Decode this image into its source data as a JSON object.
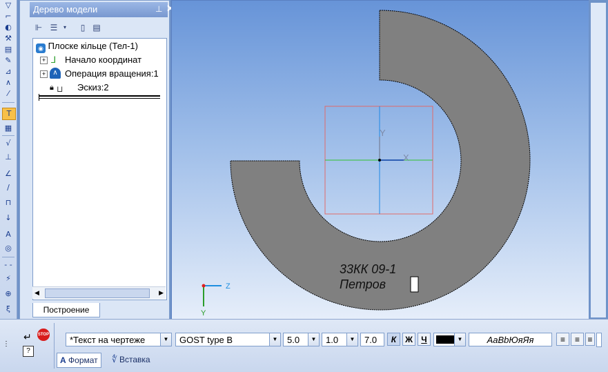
{
  "tree": {
    "title": "Дерево модели",
    "pin_icon": "pin-icon",
    "close_label": "✕",
    "items": [
      {
        "label": "Плоске кільце (Тел-1)"
      },
      {
        "label": "Начало координат"
      },
      {
        "label": "Операция вращения:1"
      },
      {
        "label": "Эскиз:2"
      }
    ],
    "tab_label": "Построение"
  },
  "viewport": {
    "axis_labels": {
      "y": "Y",
      "x": "X",
      "z": "Z",
      "y2": "Y"
    },
    "annotation_line1": "33КК 09-1",
    "annotation_line2": "Петров",
    "colors": {
      "part": "#808080",
      "sketch_box": "#e06a6a",
      "axis_y": "#1e88e5",
      "axis_x": "#2ec22e",
      "triad_z": "#1e8fe0"
    }
  },
  "format_bar": {
    "text_style": "*Текст на чертеже",
    "font": "GOST type B",
    "height": "5.0",
    "narrowing": "1.0",
    "step": "7.0",
    "italic_label": "К",
    "bold_label": "Ж",
    "underline_label": "Ч",
    "color_value": "#000000",
    "preview": "АаВbЮяЯя",
    "tabs": [
      "Формат",
      "Вставка"
    ]
  }
}
